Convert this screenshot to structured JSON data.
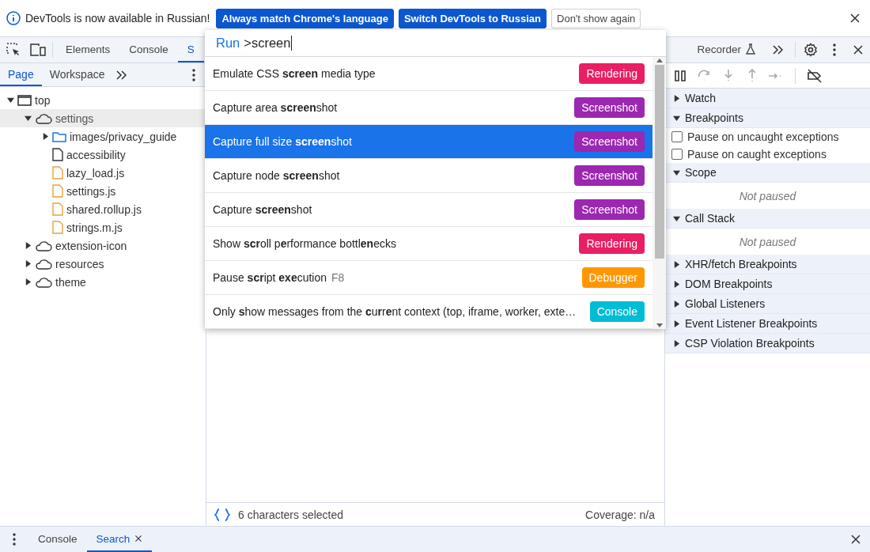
{
  "infobar": {
    "message": "DevTools is now available in Russian!",
    "buttons": [
      {
        "label": "Always match Chrome's language",
        "kind": "primary"
      },
      {
        "label": "Switch DevTools to Russian",
        "kind": "primary"
      },
      {
        "label": "Don't show again",
        "kind": "secondary"
      }
    ]
  },
  "main_tabs": [
    {
      "label": "Elements",
      "selected": false
    },
    {
      "label": "Console",
      "selected": false
    },
    {
      "label": "S",
      "selected": true
    }
  ],
  "right_tabs": [
    {
      "label": "Recorder"
    }
  ],
  "navigator": {
    "tabs": [
      {
        "label": "Page",
        "selected": true
      },
      {
        "label": "Workspace",
        "selected": false
      }
    ],
    "tree": [
      {
        "label": "top",
        "kind": "frame",
        "expanded": true,
        "selected": false,
        "children": [
          {
            "label": "settings",
            "kind": "origin",
            "expanded": true,
            "selected": true,
            "children": [
              {
                "label": "images/privacy_guide",
                "kind": "folder",
                "expanded": false,
                "selected": false
              },
              {
                "label": "accessibility",
                "kind": "document",
                "selected": false
              },
              {
                "label": "lazy_load.js",
                "kind": "script",
                "selected": false
              },
              {
                "label": "settings.js",
                "kind": "script",
                "selected": false
              },
              {
                "label": "shared.rollup.js",
                "kind": "script",
                "selected": false
              },
              {
                "label": "strings.m.js",
                "kind": "script",
                "selected": false
              }
            ]
          },
          {
            "label": "extension-icon",
            "kind": "origin",
            "expanded": false,
            "selected": false
          },
          {
            "label": "resources",
            "kind": "origin",
            "expanded": false,
            "selected": false
          },
          {
            "label": "theme",
            "kind": "origin",
            "expanded": false,
            "selected": false
          }
        ]
      }
    ]
  },
  "palette": {
    "prefix": "Run",
    "query": ">screen",
    "items": [
      {
        "title": "Emulate CSS **screen** media type",
        "badge": "Rendering",
        "color": "#e91e63",
        "selected": false
      },
      {
        "title": "Capture area **screen**shot",
        "badge": "Screenshot",
        "color": "#9c27b0",
        "selected": false
      },
      {
        "title": "Capture full size **screen**shot",
        "badge": "Screenshot",
        "color": "#9c27b0",
        "selected": true
      },
      {
        "title": "Capture node **screen**shot",
        "badge": "Screenshot",
        "color": "#9c27b0",
        "selected": false
      },
      {
        "title": "Capture **screen**shot",
        "badge": "Screenshot",
        "color": "#9c27b0",
        "selected": false
      },
      {
        "title": "Show **scr**oll p**e**rformance bottl**en**ecks",
        "badge": "Rendering",
        "color": "#e91e63",
        "selected": false
      },
      {
        "title": "Pause **scr**ipt **exe**cution",
        "shortcut": "F8",
        "badge": "Debugger",
        "color": "#ff9800",
        "selected": false
      },
      {
        "title": "Only **s**how messages from the **c**u**r**r**e**nt context (top, iframe, worker, exte…",
        "badge": "Console",
        "color": "#00bcd4",
        "selected": false
      }
    ]
  },
  "editor_status": {
    "selection": "6 characters selected",
    "coverage": "Coverage: n/a"
  },
  "debugger": {
    "sections": [
      {
        "title": "Watch",
        "expanded": false
      },
      {
        "title": "Breakpoints",
        "expanded": true,
        "options": [
          {
            "label": "Pause on uncaught exceptions",
            "checked": false
          },
          {
            "label": "Pause on caught exceptions",
            "checked": false
          }
        ]
      },
      {
        "title": "Scope",
        "expanded": true,
        "message": "Not paused"
      },
      {
        "title": "Call Stack",
        "expanded": true,
        "message": "Not paused"
      },
      {
        "title": "XHR/fetch Breakpoints",
        "expanded": false
      },
      {
        "title": "DOM Breakpoints",
        "expanded": false
      },
      {
        "title": "Global Listeners",
        "expanded": false
      },
      {
        "title": "Event Listener Breakpoints",
        "expanded": false
      },
      {
        "title": "CSP Violation Breakpoints",
        "expanded": false
      }
    ]
  },
  "drawer": {
    "tabs": [
      {
        "label": "Console",
        "selected": false,
        "closable": false
      },
      {
        "label": "Search",
        "selected": true,
        "closable": true
      }
    ]
  }
}
